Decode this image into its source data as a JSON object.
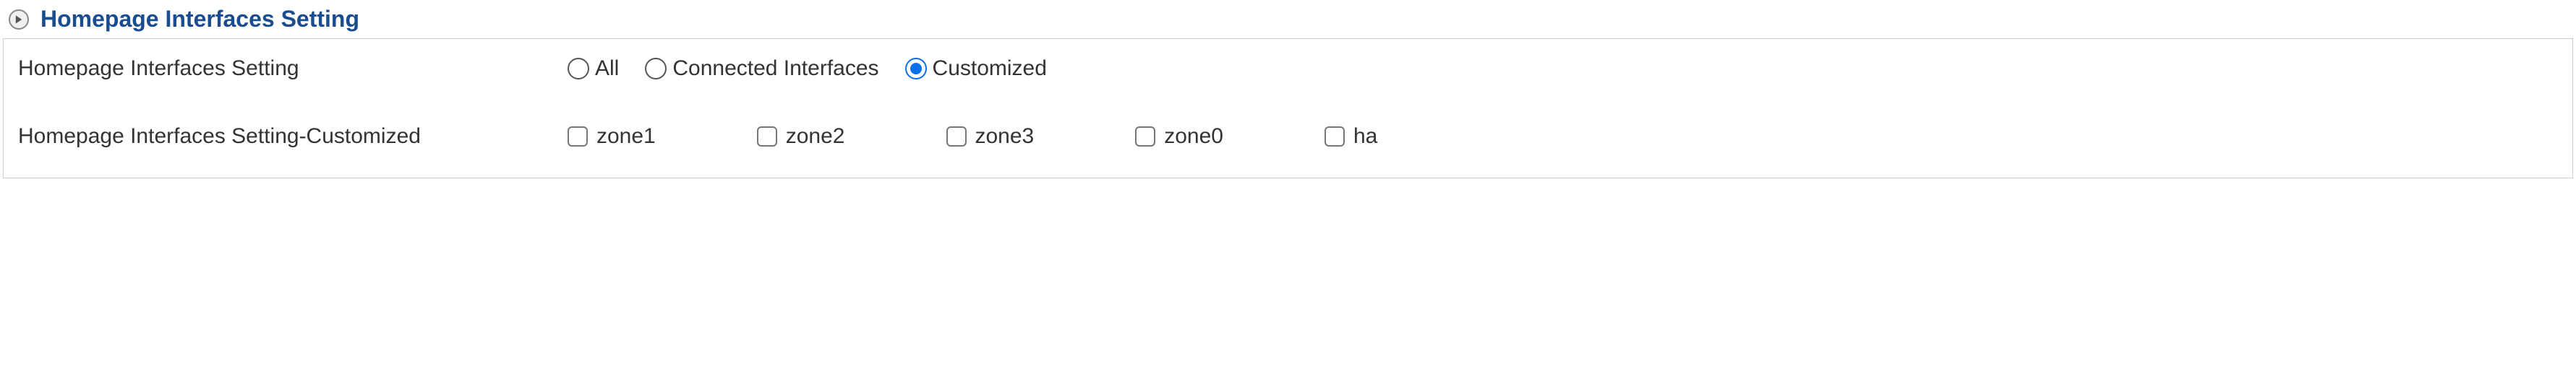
{
  "section": {
    "title": "Homepage Interfaces Setting"
  },
  "row1": {
    "label": "Homepage Interfaces Setting",
    "options": {
      "all": "All",
      "connected": "Connected Interfaces",
      "customized": "Customized"
    },
    "selected": "customized"
  },
  "row2": {
    "label": "Homepage Interfaces Setting-Customized",
    "zones": {
      "zone1": "zone1",
      "zone2": "zone2",
      "zone3": "zone3",
      "zone0": "zone0",
      "ha": "ha"
    }
  }
}
